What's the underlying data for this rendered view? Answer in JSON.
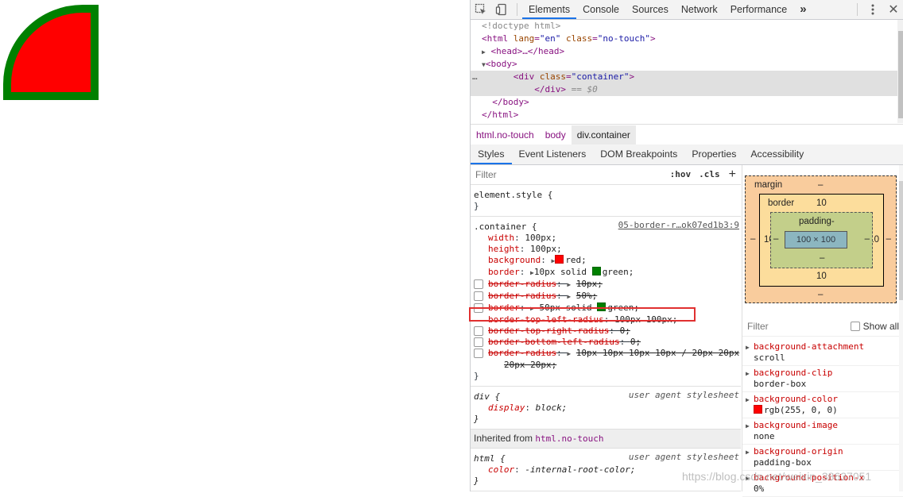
{
  "demo": {
    "background": "#ff0000",
    "border_color": "#008000"
  },
  "toolbar": {
    "tabs": [
      "Elements",
      "Console",
      "Sources",
      "Network",
      "Performance"
    ],
    "more": "»"
  },
  "dom": {
    "doctype": "<!doctype html>",
    "html_open_tag": "<html",
    "html_attr1": "lang",
    "html_attr1_val": "\"en\"",
    "html_attr2": "class",
    "html_attr2_val": "\"no-touch\"",
    "head_collapsed": "<head>…</head>",
    "body_open": "<body>",
    "div_tag": "<div",
    "div_attr": "class",
    "div_attr_val": "\"container\"",
    "div_close": "</div>",
    "selected_marker": "== $0",
    "body_close": "</body>",
    "html_close": "</html>",
    "dots": "…"
  },
  "breadcrumbs": [
    "html.no-touch",
    "body",
    "div.container"
  ],
  "subtabs": [
    "Styles",
    "Event Listeners",
    "DOM Breakpoints",
    "Properties",
    "Accessibility"
  ],
  "styles": {
    "filter_placeholder": "Filter",
    "hov": ":hov",
    "cls": ".cls",
    "plus": "+",
    "element_style": "element.style {",
    "close_brace": "}",
    "container_selector": ".container {",
    "container_source": "05-border-r…ok07ed1b3:9",
    "props": [
      {
        "name": "width",
        "value": "100px;"
      },
      {
        "name": "height",
        "value": "100px;"
      },
      {
        "name": "background",
        "value": "red;",
        "swatch": "#ff0000"
      },
      {
        "name": "border",
        "value": "10px solid ",
        "swatch": "#008000",
        "after": "green;"
      }
    ],
    "struck": [
      {
        "name": "border-radius",
        "value": "10px;"
      },
      {
        "name": "border-radius",
        "value": "50%;"
      },
      {
        "name": "border",
        "value": "50px solid ",
        "swatch": "#008000",
        "after": "green;"
      }
    ],
    "active_prop": {
      "name": "border-top-left-radius",
      "value": "100px 100px;"
    },
    "struck2": [
      {
        "name": "border-top-right-radius",
        "value": "0;"
      },
      {
        "name": "border-bottom-left-radius",
        "value": "0;"
      },
      {
        "name": "border-radius",
        "value": "10px 10px 10px 10px / 20px 20px",
        "cont": "20px 20px;"
      }
    ],
    "div_selector": "div {",
    "ua_source": "user agent stylesheet",
    "div_display": {
      "name": "display",
      "value": "block;"
    },
    "inherited_label": "Inherited from ",
    "inherited_from": "html.no-touch",
    "html_selector": "html {",
    "html_color": {
      "name": "color",
      "value": "-internal-root-color;"
    }
  },
  "boxmodel": {
    "margin_label": "margin",
    "margin_val": "–",
    "border_label": "border",
    "border_val": "10",
    "padding_label": "padding-",
    "padding_bottom": "–",
    "content": "100 × 100",
    "side_dash": "–",
    "border_side": "10",
    "border_bottom": "10",
    "margin_bottom": "–"
  },
  "computed": {
    "filter_placeholder": "Filter",
    "show_all": "Show all",
    "items": [
      {
        "name": "background-attachment",
        "value": "scroll"
      },
      {
        "name": "background-clip",
        "value": "border-box"
      },
      {
        "name": "background-color",
        "value": "rgb(255, 0, 0)",
        "swatch": "#ff0000"
      },
      {
        "name": "background-image",
        "value": "none"
      },
      {
        "name": "background-origin",
        "value": "padding-box"
      },
      {
        "name": "background-position-x",
        "value": "0%"
      }
    ]
  },
  "watermark": "https://blog.csdn.net/weixin_38637051"
}
